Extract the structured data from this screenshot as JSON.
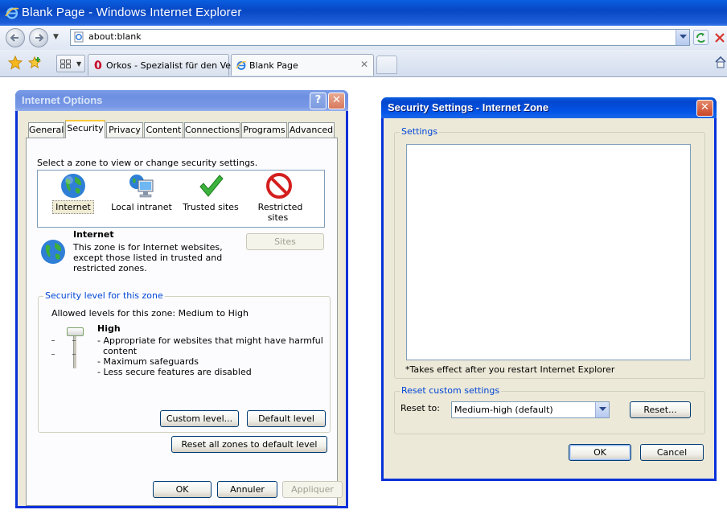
{
  "browser": {
    "title": "Blank Page - Windows Internet Explorer",
    "address": "about:blank",
    "tabs": [
      {
        "label": "Orkos - Spezialist für den Ver..."
      },
      {
        "label": "Blank Page"
      }
    ]
  },
  "internet_options": {
    "title": "Internet Options",
    "help_glyph": "?",
    "close_glyph": "✕",
    "tabs": [
      "General",
      "Security",
      "Privacy",
      "Content",
      "Connections",
      "Programs",
      "Advanced"
    ],
    "selected_tab": "Security",
    "zone_prompt": "Select a zone to view or change security settings.",
    "zones": [
      "Internet",
      "Local intranet",
      "Trusted sites",
      "Restricted sites"
    ],
    "selected_zone": "Internet",
    "zone_name": "Internet",
    "zone_desc": [
      "This zone is for Internet websites,",
      "except those listed in trusted and",
      "restricted zones."
    ],
    "sites_button": "Sites",
    "security_level_group": "Security level for this zone",
    "allowed_levels": "Allowed levels for this zone: Medium to High",
    "level_name": "High",
    "level_bullets": [
      "- Appropriate for websites that might have harmful",
      "content",
      "- Maximum safeguards",
      "- Less secure features are disabled"
    ],
    "custom_level_button": "Custom level...",
    "default_level_button": "Default level",
    "reset_all_button": "Reset all zones to default level",
    "ok_button": "OK",
    "cancel_button": "Annuler",
    "apply_button": "Appliquer"
  },
  "security_settings": {
    "title": "Security Settings - Internet Zone",
    "close_glyph": "✕",
    "settings_group": "Settings",
    "restart_note": "*Takes effect after you restart Internet Explorer",
    "reset_group": "Reset custom settings",
    "reset_to_label": "Reset to:",
    "reset_to_value": "Medium-high (default)",
    "reset_button": "Reset...",
    "ok_button": "OK",
    "cancel_button": "Cancel"
  },
  "colors": {
    "xp_blue": "#0831d9",
    "dialog_face": "#ece9d8",
    "groupbox_label": "#0046d5"
  }
}
